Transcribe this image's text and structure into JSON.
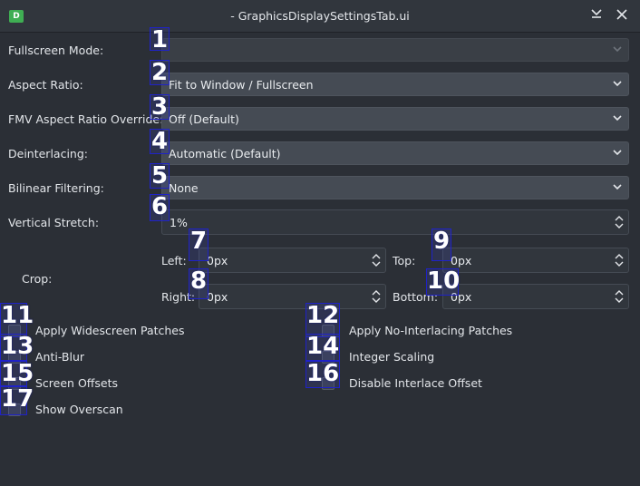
{
  "window": {
    "title": "- GraphicsDisplaySettingsTab.ui",
    "icon_text": "D"
  },
  "form": {
    "fullscreen_mode": {
      "label": "Fullscreen Mode:",
      "value": ""
    },
    "aspect_ratio": {
      "label": "Aspect Ratio:",
      "value": "Fit to Window / Fullscreen"
    },
    "fmv_aspect_ratio": {
      "label": "FMV Aspect Ratio Override:",
      "value": "Off (Default)"
    },
    "deinterlacing": {
      "label": "Deinterlacing:",
      "value": "Automatic (Default)"
    },
    "bilinear_filtering": {
      "label": "Bilinear Filtering:",
      "value": "None"
    },
    "vertical_stretch": {
      "label": "Vertical Stretch:",
      "value": "1%"
    },
    "crop": {
      "label": "Crop:",
      "left": {
        "label": "Left:",
        "value": "0px"
      },
      "top": {
        "label": "Top:",
        "value": "0px"
      },
      "right": {
        "label": "Right:",
        "value": "0px"
      },
      "bottom": {
        "label": "Bottom:",
        "value": "0px"
      }
    }
  },
  "checkboxes": {
    "widescreen": "Apply Widescreen Patches",
    "no_interlacing": "Apply No-Interlacing Patches",
    "anti_blur": "Anti-Blur",
    "integer_scaling": "Integer Scaling",
    "screen_offsets": "Screen Offsets",
    "disable_interlace_offset": "Disable Interlace Offset",
    "show_overscan": "Show Overscan"
  },
  "annotations": [
    "1",
    "2",
    "3",
    "4",
    "5",
    "6",
    "7",
    "8",
    "9",
    "10",
    "11",
    "12",
    "13",
    "14",
    "15",
    "16",
    "17"
  ],
  "colors": {
    "background": "#2b2f36",
    "annotation_box": "#1f22c8"
  }
}
